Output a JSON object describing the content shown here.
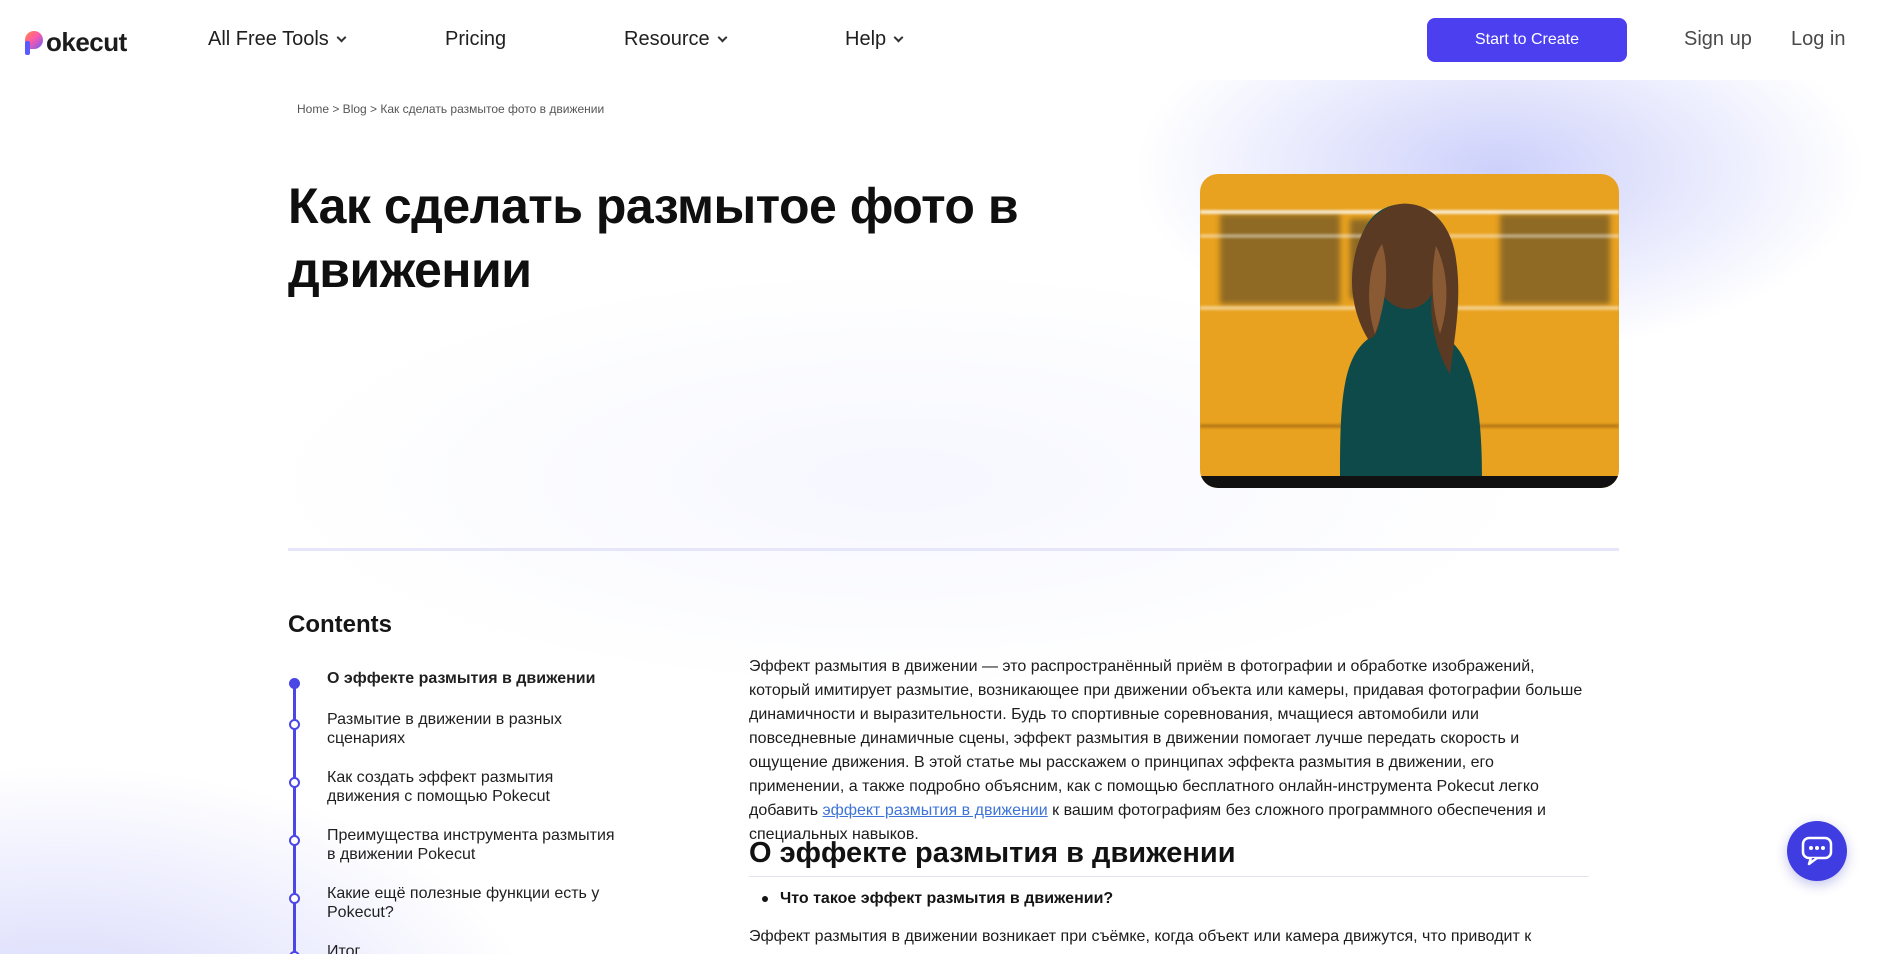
{
  "header": {
    "logo_text": "okecut",
    "nav": [
      "All Free Tools",
      "Pricing",
      "Resource",
      "Help"
    ],
    "cta_label": "Start to Create",
    "signup_label": "Sign up",
    "login_label": "Log in"
  },
  "breadcrumb": "Home > Blog > Как сделать размытое фото в движении",
  "title": "Как сделать размытое фото в движении",
  "contents": {
    "title": "Contents",
    "items": [
      "О эффекте размытия в движении",
      "Размытие в движении в разных сценариях",
      "Как создать эффект размытия движения с помощью Pokecut",
      "Преимущества инструмента размытия в движении Pokecut",
      "Какие ещё полезные функции есть у Pokecut?",
      "Итог"
    ]
  },
  "article": {
    "intro_before_link": "Эффект размытия в движении — это распространённый приём в фотографии и обработке изображений, который имитирует размытие, возникающее при движении объекта или камеры, придавая фотографии больше динамичности и выразительности. Будь то спортивные соревнования, мчащиеся автомобили или повседневные динамичные сцены, эффект размытия в движении помогает лучше передать скорость и ощущение движения. В этой статье мы расскажем о принципах эффекта размытия в движении, его применении, а также подробно объясним, как с помощью бесплатного онлайн-инструмента Pokecut легко добавить ",
    "intro_link": "эффект размытия в движении",
    "intro_after_link": " к вашим фотографиям без сложного программного обеспечения и специальных навыков.",
    "h2": "О эффекте размытия в движении",
    "bullet": "Что такое эффект размытия в движении?",
    "para2": "Эффект размытия в движении возникает при съёмке, когда объект или камера движутся, что приводит к"
  }
}
